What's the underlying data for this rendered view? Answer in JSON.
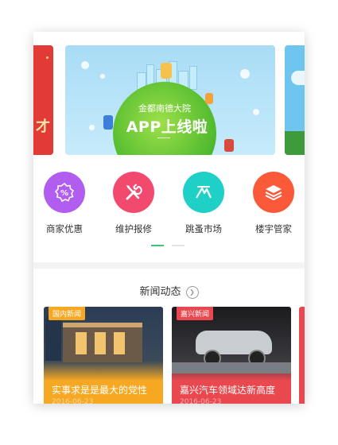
{
  "banner": {
    "subtitle": "金都南德大院",
    "headline": "APP上线啦",
    "left_partial_char": "才"
  },
  "menu": [
    {
      "label": "商家优惠",
      "icon": "percent-badge-icon",
      "color": "#b05df0"
    },
    {
      "label": "维护报修",
      "icon": "tools-icon",
      "color": "#f24a6f"
    },
    {
      "label": "跳蚤市场",
      "icon": "market-icon",
      "color": "#1fd0c6"
    },
    {
      "label": "楼宇管家",
      "icon": "layers-icon",
      "color": "#fb5a3a"
    }
  ],
  "news": {
    "heading": "新闻动态",
    "cards": [
      {
        "category": "国内新闻",
        "title": "实事求是是最大的党性",
        "date": "2016-06-23",
        "category_color": "#f7a823"
      },
      {
        "category": "嘉兴新闻",
        "title": "嘉兴汽车领域达新高度",
        "date": "2016-06-23",
        "category_color": "#e9484e"
      }
    ]
  },
  "pager": {
    "count": 2,
    "active": 0
  }
}
